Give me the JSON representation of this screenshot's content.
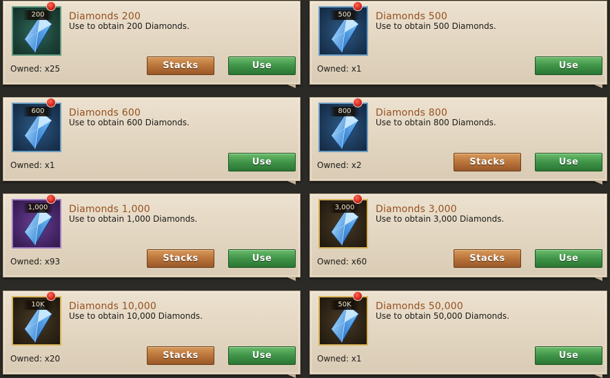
{
  "items": [
    {
      "badge": "200",
      "title": "Diamonds 200",
      "desc": "Use to obtain 200 Diamonds.",
      "owned": "Owned: x25",
      "rarity": "green",
      "stacks_label": "Stacks",
      "use_label": "Use",
      "has_stacks": true
    },
    {
      "badge": "500",
      "title": "Diamonds 500",
      "desc": "Use to obtain 500 Diamonds.",
      "owned": "Owned: x1",
      "rarity": "blue",
      "stacks_label": "",
      "use_label": "Use",
      "has_stacks": false
    },
    {
      "badge": "600",
      "title": "Diamonds 600",
      "desc": "Use to obtain 600 Diamonds.",
      "owned": "Owned: x1",
      "rarity": "blue",
      "stacks_label": "",
      "use_label": "Use",
      "has_stacks": false
    },
    {
      "badge": "800",
      "title": "Diamonds 800",
      "desc": "Use to obtain 800 Diamonds.",
      "owned": "Owned: x2",
      "rarity": "blue",
      "stacks_label": "Stacks",
      "use_label": "Use",
      "has_stacks": true
    },
    {
      "badge": "1,000",
      "title": "Diamonds 1,000",
      "desc": "Use to obtain 1,000 Diamonds.",
      "owned": "Owned: x93",
      "rarity": "purple",
      "stacks_label": "Stacks",
      "use_label": "Use",
      "has_stacks": true
    },
    {
      "badge": "3,000",
      "title": "Diamonds 3,000",
      "desc": "Use to obtain 3,000 Diamonds.",
      "owned": "Owned: x60",
      "rarity": "gold",
      "stacks_label": "Stacks",
      "use_label": "Use",
      "has_stacks": true
    },
    {
      "badge": "10K",
      "title": "Diamonds 10,000",
      "desc": "Use to obtain 10,000 Diamonds.",
      "owned": "Owned: x20",
      "rarity": "gold",
      "stacks_label": "Stacks",
      "use_label": "Use",
      "has_stacks": true
    },
    {
      "badge": "50K",
      "title": "Diamonds 50,000",
      "desc": "Use to obtain 50,000 Diamonds.",
      "owned": "Owned: x1",
      "rarity": "gold",
      "stacks_label": "",
      "use_label": "Use",
      "has_stacks": false
    }
  ],
  "colors": {
    "title": "#94501f",
    "stacks_button": "#b9743a",
    "use_button": "#3f9448",
    "notification_dot": "#d42a1e"
  },
  "icons": {
    "item": "blue-diamond-icon",
    "notification": "red-dot-icon"
  }
}
